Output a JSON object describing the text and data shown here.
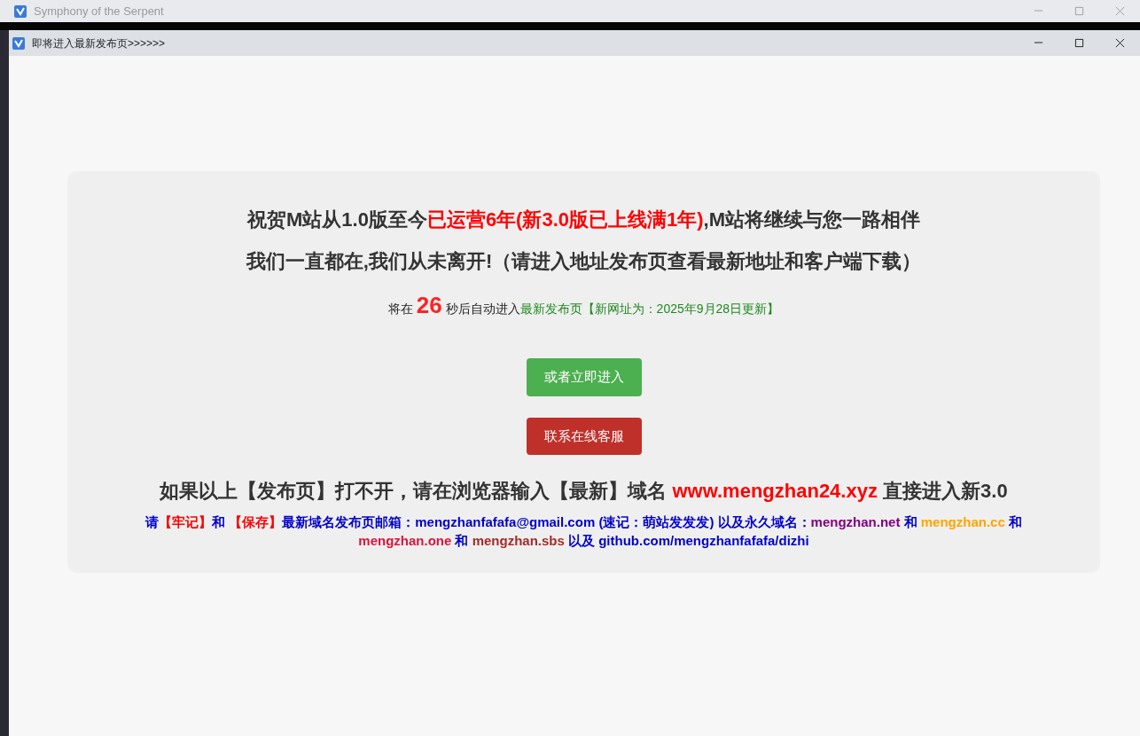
{
  "back_window": {
    "title": "Symphony of the Serpent"
  },
  "window": {
    "title": "即将进入最新发布页>>>>>>"
  },
  "headline": [
    {
      "text": "祝贺M站从1.0版至今",
      "color": "#333333"
    },
    {
      "text": "已运营6年(新3.0版已上线满1年)",
      "color": "#ff0000"
    },
    {
      "text": ",M站将继续与您一路相伴",
      "color": "#333333"
    }
  ],
  "subheadline": "我们一直都在,我们从未离开!（请进入地址发布页查看最新地址和客户端下载）",
  "countdown": [
    {
      "text": "将在 ",
      "color": "#222222",
      "kind": "text"
    },
    {
      "text": "26",
      "color": "#ff2222",
      "kind": "number"
    },
    {
      "text": " 秒后自动进入",
      "color": "#222222",
      "kind": "text"
    },
    {
      "text": "最新发布页",
      "color": "#228822",
      "kind": "text"
    },
    {
      "text": "【新网址为：2025年9月28日更新】",
      "color": "#228822",
      "kind": "text"
    }
  ],
  "buttons": [
    {
      "label": "或者立即进入",
      "color": "#4caf50"
    },
    {
      "label": "联系在线客服",
      "color": "#c0302a"
    }
  ],
  "notice": [
    {
      "text": "如果以上【发布页】打不开，请在浏览器输入【最新】域名 ",
      "color": "#333333"
    },
    {
      "text": "www.mengzhan24.xyz",
      "color": "#ff0000"
    },
    {
      "text": " 直接进入新3.0",
      "color": "#333333"
    }
  ],
  "footer": [
    {
      "text": "请",
      "color": "#0000cc"
    },
    {
      "text": "【牢记】",
      "color": "#ff0000"
    },
    {
      "text": "和 ",
      "color": "#0000cc"
    },
    {
      "text": "【保存】",
      "color": "#ff0000"
    },
    {
      "text": "最新域名发布页邮箱：mengzhanfafafa@gmail.com (速记：萌站发发发) 以及永久域名：",
      "color": "#0000cc"
    },
    {
      "text": "mengzhan.net",
      "color": "#800080"
    },
    {
      "text": " 和 ",
      "color": "#0000cc"
    },
    {
      "text": "mengzhan.cc",
      "color": "#ffa500"
    },
    {
      "text": " 和 ",
      "color": "#0000cc"
    },
    {
      "text": "mengzhan.one",
      "color": "#dc143c"
    },
    {
      "text": " 和 ",
      "color": "#0000cc"
    },
    {
      "text": "mengzhan.sbs",
      "color": "#a52a2a"
    },
    {
      "text": " 以及 github.com/mengzhanfafafa/dizhi",
      "color": "#0000cc"
    }
  ]
}
